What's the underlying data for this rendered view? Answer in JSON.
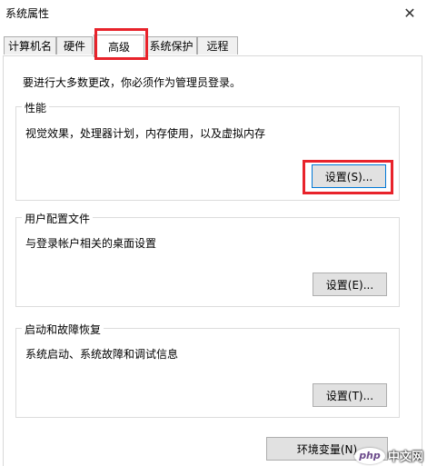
{
  "window": {
    "title": "系统属性",
    "close_glyph": "✕"
  },
  "tabs": [
    {
      "label": "计算机名"
    },
    {
      "label": "硬件"
    },
    {
      "label": "高级"
    },
    {
      "label": "系统保护"
    },
    {
      "label": "远程"
    }
  ],
  "notice": "要进行大多数更改，你必须作为管理员登录。",
  "performance": {
    "title": "性能",
    "description": "视觉效果，处理器计划，内存使用，以及虚拟内存",
    "button": "设置(S)..."
  },
  "user_profiles": {
    "title": "用户配置文件",
    "description": "与登录帐户相关的桌面设置",
    "button": "设置(E)..."
  },
  "startup_recovery": {
    "title": "启动和故障恢复",
    "description": "系统启动、系统故障和调试信息",
    "button": "设置(T)..."
  },
  "env_button": "环境变量(N)",
  "watermark": {
    "logo": "php",
    "text": "中文网"
  },
  "colors": {
    "highlight": "#e8232b",
    "focus": "#0078d7"
  }
}
